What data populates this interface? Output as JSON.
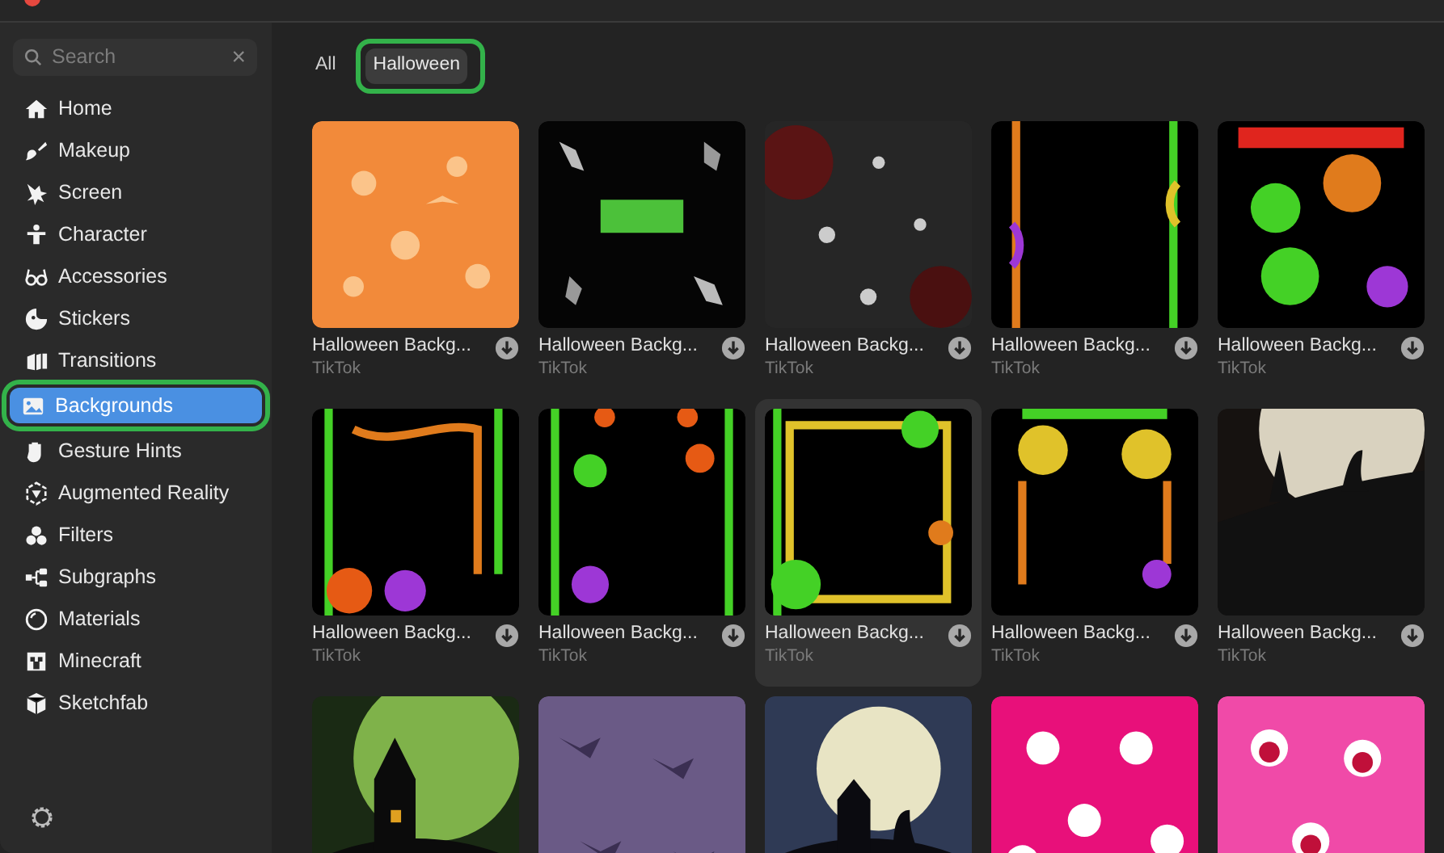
{
  "search": {
    "placeholder": "Search",
    "clear": "×"
  },
  "sidebar": {
    "items": [
      {
        "label": "Home",
        "selected": false,
        "annotated": false
      },
      {
        "label": "Makeup",
        "selected": false,
        "annotated": false
      },
      {
        "label": "Screen",
        "selected": false,
        "annotated": false
      },
      {
        "label": "Character",
        "selected": false,
        "annotated": false
      },
      {
        "label": "Accessories",
        "selected": false,
        "annotated": false
      },
      {
        "label": "Stickers",
        "selected": false,
        "annotated": false
      },
      {
        "label": "Transitions",
        "selected": false,
        "annotated": false
      },
      {
        "label": "Backgrounds",
        "selected": true,
        "annotated": true
      },
      {
        "label": "Gesture Hints",
        "selected": false,
        "annotated": false
      },
      {
        "label": "Augmented Reality",
        "selected": false,
        "annotated": false
      },
      {
        "label": "Filters",
        "selected": false,
        "annotated": false
      },
      {
        "label": "Subgraphs",
        "selected": false,
        "annotated": false
      },
      {
        "label": "Materials",
        "selected": false,
        "annotated": false
      },
      {
        "label": "Minecraft",
        "selected": false,
        "annotated": false
      },
      {
        "label": "Sketchfab",
        "selected": false,
        "annotated": false
      }
    ]
  },
  "filters": [
    {
      "label": "All",
      "selected": false,
      "annotated": false
    },
    {
      "label": "Halloween",
      "selected": true,
      "annotated": true
    }
  ],
  "cards": [
    {
      "kind": "item",
      "title": "Halloween Backg...",
      "source": "TikTok",
      "hovered": false
    },
    {
      "kind": "item",
      "title": "Halloween Backg...",
      "source": "TikTok",
      "hovered": false
    },
    {
      "kind": "item",
      "title": "Halloween Backg...",
      "source": "TikTok",
      "hovered": false
    },
    {
      "kind": "item",
      "title": "Halloween Backg...",
      "source": "TikTok",
      "hovered": false
    },
    {
      "kind": "item",
      "title": "Halloween Backg...",
      "source": "TikTok",
      "hovered": false
    },
    {
      "kind": "item",
      "title": "Halloween Backg...",
      "source": "TikTok",
      "hovered": false
    },
    {
      "kind": "item",
      "title": "Halloween Backg...",
      "source": "TikTok",
      "hovered": false
    },
    {
      "kind": "item",
      "title": "Halloween Backg...",
      "source": "TikTok",
      "hovered": true
    },
    {
      "kind": "item",
      "title": "Halloween Backg...",
      "source": "TikTok",
      "hovered": false
    },
    {
      "kind": "item",
      "title": "Halloween Backg...",
      "source": "TikTok",
      "hovered": false
    },
    {
      "kind": "picture"
    },
    {
      "kind": "picture"
    },
    {
      "kind": "picture"
    },
    {
      "kind": "picture"
    },
    {
      "kind": "picture"
    }
  ]
}
